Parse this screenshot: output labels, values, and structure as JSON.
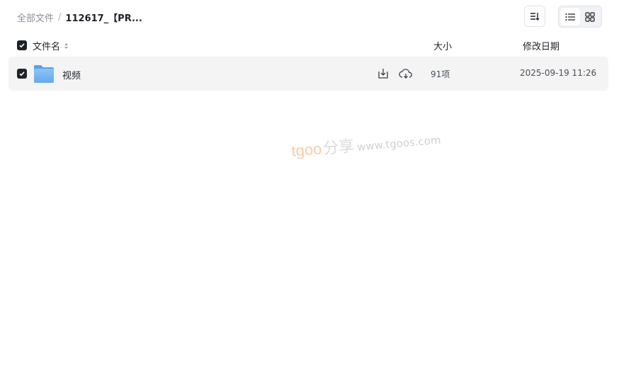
{
  "breadcrumb": {
    "root": "全部文件",
    "separator": "/",
    "current": "112617_【PR..."
  },
  "toolbar": {
    "sort_icon": "sort-lines-icon",
    "view_list_icon": "list-view-icon",
    "view_grid_icon": "grid-view-icon",
    "active_view": "list"
  },
  "table": {
    "columns": {
      "name": "文件名",
      "size": "大小",
      "modified": "修改日期"
    },
    "select_all_checked": true,
    "rows": [
      {
        "checked": true,
        "type": "folder",
        "name": "视频",
        "size": "91项",
        "modified": "2025-09-19 11:26"
      }
    ]
  },
  "watermark": {
    "brand": "tgoo",
    "share": "分享",
    "url": "www.tgoos.com"
  },
  "colors": {
    "accent_dark": "#1f2329",
    "row_highlight": "#f4f4f5",
    "folder_blue": "#7ab7f2",
    "watermark_orange": "#f2a25c"
  }
}
